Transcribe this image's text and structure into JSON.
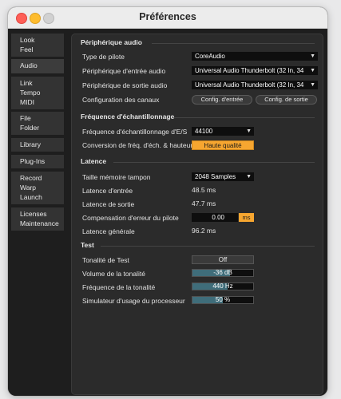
{
  "window": {
    "title": "Préférences"
  },
  "sidebar": {
    "tabs": [
      {
        "lines": [
          "Look",
          "Feel"
        ]
      },
      {
        "lines": [
          "Audio"
        ]
      },
      {
        "lines": [
          "Link",
          "Tempo",
          "MIDI"
        ]
      },
      {
        "lines": [
          "File",
          "Folder"
        ]
      },
      {
        "lines": [
          "Library"
        ]
      },
      {
        "lines": [
          "Plug-Ins"
        ]
      },
      {
        "lines": [
          "Record",
          "Warp",
          "Launch"
        ]
      },
      {
        "lines": [
          "Licenses",
          "Maintenance"
        ]
      }
    ],
    "active": "Audio"
  },
  "audio_device": {
    "heading": "Périphérique audio",
    "driver_type_label": "Type de pilote",
    "driver_type_value": "CoreAudio",
    "input_device_label": "Périphérique d'entrée audio",
    "input_device_value": "Universal Audio Thunderbolt (32 In, 34",
    "output_device_label": "Périphérique de sortie audio",
    "output_device_value": "Universal Audio Thunderbolt (32 In, 34",
    "channel_config_label": "Configuration des canaux",
    "input_config_button": "Config. d'entrée",
    "output_config_button": "Config. de sortie"
  },
  "sample_rate": {
    "heading": "Fréquence d'échantillonnage",
    "io_rate_label": "Fréquence d'échantillonnage d'E/S",
    "io_rate_value": "44100",
    "conversion_label": "Conversion de fréq. d'éch. & hauteur",
    "conversion_value": "Haute qualité"
  },
  "latency": {
    "heading": "Latence",
    "buffer_size_label": "Taille mémoire tampon",
    "buffer_size_value": "2048 Samples",
    "input_latency_label": "Latence d'entrée",
    "input_latency_value": "48.5 ms",
    "output_latency_label": "Latence de sortie",
    "output_latency_value": "47.7 ms",
    "driver_error_label": "Compensation d'erreur du pilote",
    "driver_error_value": "0.00",
    "driver_error_unit": "ms",
    "overall_latency_label": "Latence générale",
    "overall_latency_value": "96.2 ms"
  },
  "test": {
    "heading": "Test",
    "tone_label": "Tonalité de Test",
    "tone_value": "Off",
    "volume_label": "Volume de la tonalité",
    "volume_value": "-36 dB",
    "volume_fraction": 0.62,
    "frequency_label": "Fréquence de la tonalité",
    "frequency_value": "440 Hz",
    "frequency_fraction": 0.58,
    "cpu_label": "Simulateur d'usage du processeur",
    "cpu_value": "50 %",
    "cpu_fraction": 0.5
  },
  "colors": {
    "accent_orange": "#f6a630",
    "bar_fill": "#3f6d7a"
  }
}
